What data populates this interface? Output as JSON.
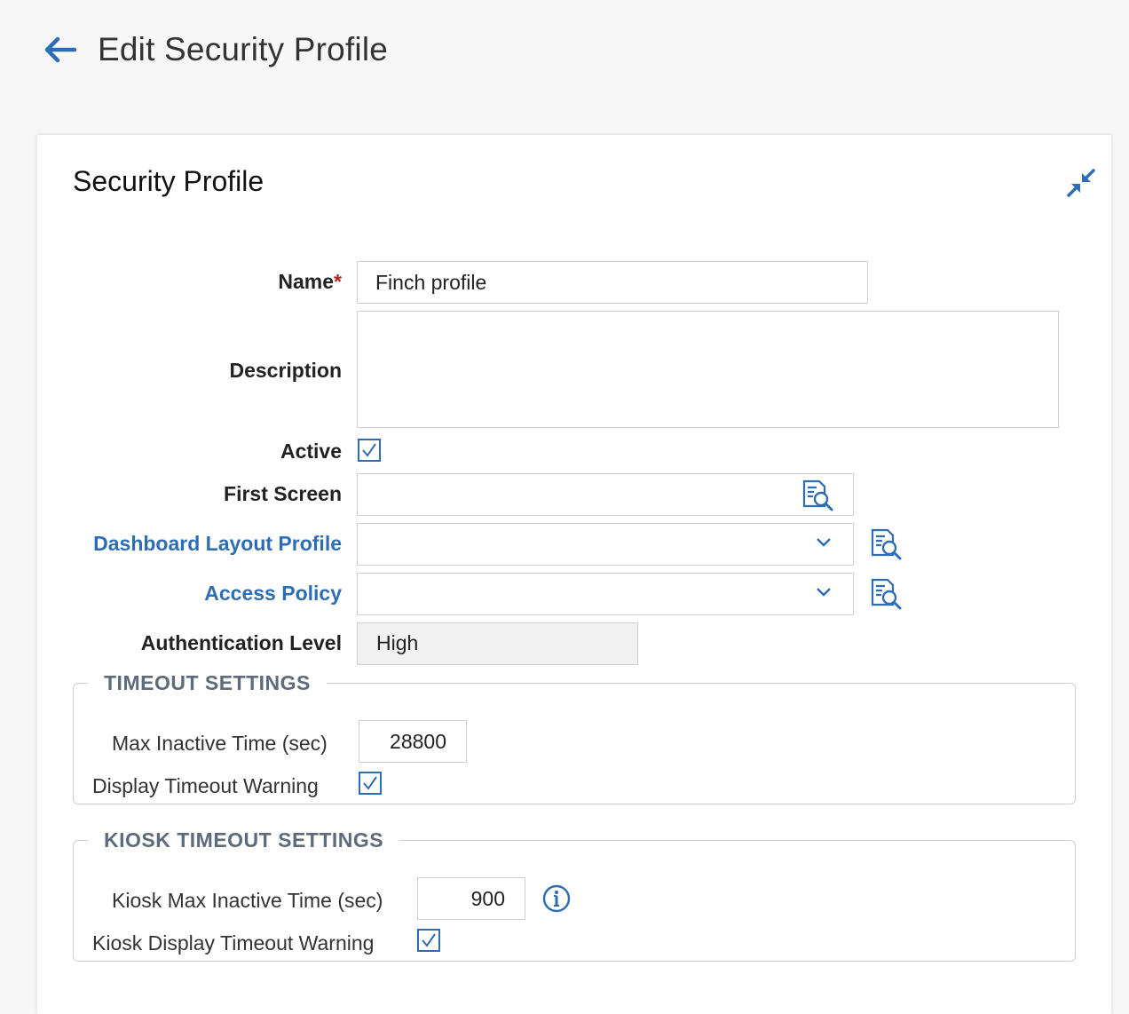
{
  "header": {
    "title": "Edit Security Profile",
    "back_icon": "arrow-left-icon"
  },
  "card": {
    "title": "Security Profile",
    "collapse_icon": "collapse-arrows-icon"
  },
  "form": {
    "name": {
      "label": "Name",
      "required_mark": "*",
      "value": "Finch profile"
    },
    "description": {
      "label": "Description",
      "value": ""
    },
    "active": {
      "label": "Active",
      "checked": true
    },
    "first_screen": {
      "label": "First Screen",
      "value": ""
    },
    "dashboard_layout_profile": {
      "label": "Dashboard Layout Profile",
      "value": ""
    },
    "access_policy": {
      "label": "Access Policy",
      "value": ""
    },
    "authentication_level": {
      "label": "Authentication Level",
      "value": "High"
    }
  },
  "timeout_settings": {
    "title": "TIMEOUT SETTINGS",
    "max_inactive_label": "Max Inactive Time (sec)",
    "max_inactive_value": "28800",
    "display_warning_label": "Display Timeout Warning",
    "display_warning_checked": true
  },
  "kiosk_timeout_settings": {
    "title": "KIOSK TIMEOUT SETTINGS",
    "max_inactive_label": "Kiosk Max Inactive Time (sec)",
    "max_inactive_value": "900",
    "display_warning_label": "Kiosk Display Timeout Warning",
    "display_warning_checked": true
  },
  "colors": {
    "accent": "#2d6db5",
    "required": "#b22222",
    "legend": "#5f6b7a",
    "border": "#cfcfcf"
  }
}
